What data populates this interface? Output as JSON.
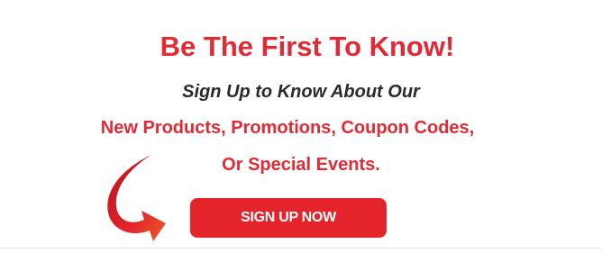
{
  "signup": {
    "headline": "Be The First To Know!",
    "subline": "Sign Up to Know About Our",
    "line2": "New Products, Promotions, Coupon Codes,",
    "line3": "Or Special Events.",
    "button_label": "SIGN UP NOW"
  },
  "colors": {
    "accent": "#e02b35",
    "button": "#e3242b",
    "subline_text": "#2a2a2a",
    "background": "#ffffff",
    "divider": "#e2e2e2"
  },
  "icons": {
    "arrow": "curved-arrow-icon"
  }
}
